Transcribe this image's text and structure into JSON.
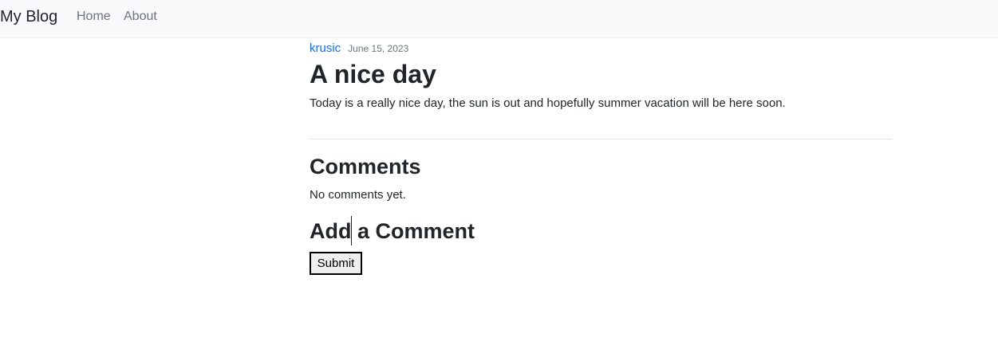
{
  "navbar": {
    "brand": "My Blog",
    "links": [
      {
        "label": "Home"
      },
      {
        "label": "About"
      }
    ]
  },
  "post": {
    "author": "krusic",
    "date": "June 15, 2023",
    "title": "A nice day",
    "body": "Today is a really nice day, the sun is out and hopefully summer vacation will be here soon."
  },
  "comments": {
    "heading": "Comments",
    "empty_text": "No comments yet.",
    "add_heading": "Add a Comment",
    "submit_label": "Submit"
  },
  "colors": {
    "navbar_bg": "#f8f9fa",
    "link_accent": "#0d6efd",
    "muted_text": "#6c757d",
    "body_text": "#212529"
  }
}
